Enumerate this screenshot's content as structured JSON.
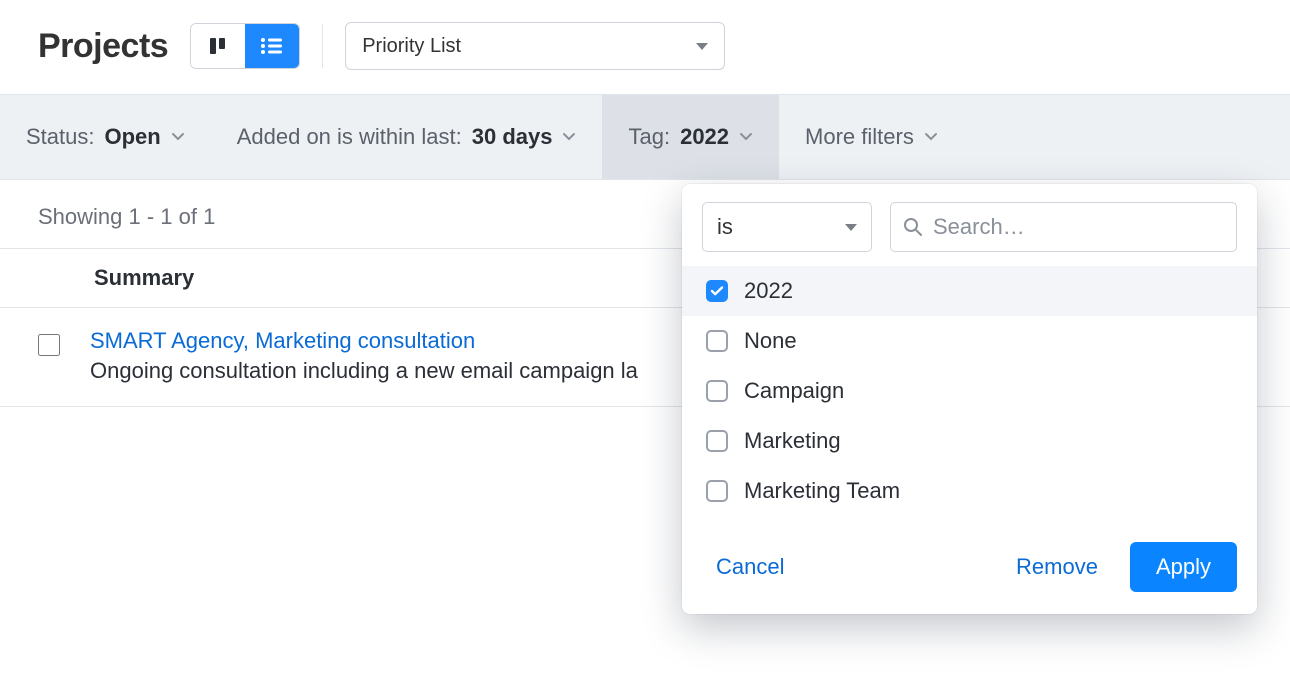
{
  "header": {
    "title": "Projects",
    "select_label": "Priority List"
  },
  "filters": {
    "status": {
      "label": "Status:",
      "value": "Open"
    },
    "added": {
      "label": "Added on is within last:",
      "value": "30 days"
    },
    "tag": {
      "label": "Tag:",
      "value": "2022"
    },
    "more": {
      "label": "More filters"
    }
  },
  "results": {
    "meta": "Showing 1 - 1 of 1",
    "summary_col": "Summary",
    "rows": [
      {
        "title": "SMART Agency, Marketing consultation",
        "desc": "Ongoing consultation including a new email campaign la"
      }
    ]
  },
  "tag_panel": {
    "operator": "is",
    "search_placeholder": "Search…",
    "options": [
      {
        "label": "2022",
        "checked": true
      },
      {
        "label": "None",
        "checked": false
      },
      {
        "label": "Campaign",
        "checked": false
      },
      {
        "label": "Marketing",
        "checked": false
      },
      {
        "label": "Marketing Team",
        "checked": false
      }
    ],
    "cancel": "Cancel",
    "remove": "Remove",
    "apply": "Apply"
  }
}
